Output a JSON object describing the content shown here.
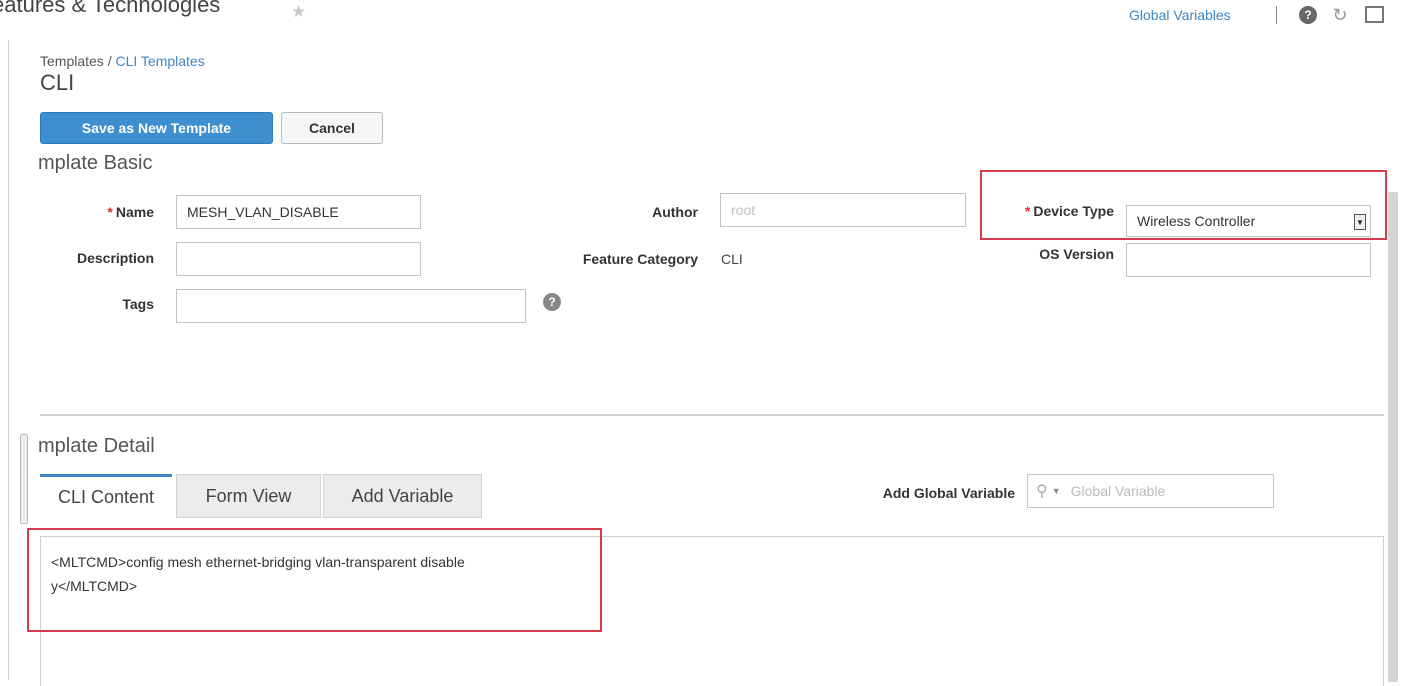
{
  "header": {
    "title": "eatures & Technologies",
    "global_variables_link": "Global Variables",
    "icons": [
      "star-icon",
      "help-icon",
      "refresh-icon",
      "maximize-icon"
    ]
  },
  "breadcrumb": {
    "root": "Templates / ",
    "current": "CLI Templates"
  },
  "page": {
    "subtitle": "CLI"
  },
  "actions": {
    "save_label": "Save as New Template",
    "cancel_label": "Cancel"
  },
  "template_basic": {
    "section_title": "mplate Basic",
    "name": {
      "label": "Name",
      "value": "MESH_VLAN_DISABLE",
      "required": true
    },
    "description": {
      "label": "Description",
      "value": ""
    },
    "tags": {
      "label": "Tags",
      "value": ""
    },
    "author": {
      "label": "Author",
      "placeholder": "root"
    },
    "feature_category": {
      "label": "Feature Category",
      "value": "CLI"
    },
    "device_type": {
      "label": "Device Type",
      "value": "Wireless Controller",
      "required": true
    },
    "os_version": {
      "label": "OS Version",
      "value": ""
    }
  },
  "template_detail": {
    "section_title": "mplate Detail",
    "tabs": [
      {
        "label": "CLI Content",
        "active": true
      },
      {
        "label": "Form View",
        "active": false
      },
      {
        "label": "Add Variable",
        "active": false
      }
    ],
    "add_global_variable": {
      "label": "Add Global Variable",
      "placeholder": "Global Variable"
    },
    "cli_content": [
      "<MLTCMD>config mesh ethernet-bridging vlan-transparent disable",
      "y</MLTCMD>"
    ]
  },
  "colors": {
    "accent": "#3f86c4",
    "primary_button": "#3e8fd0",
    "highlight_box": "#d23b47",
    "required_mark": "#d9342b"
  }
}
